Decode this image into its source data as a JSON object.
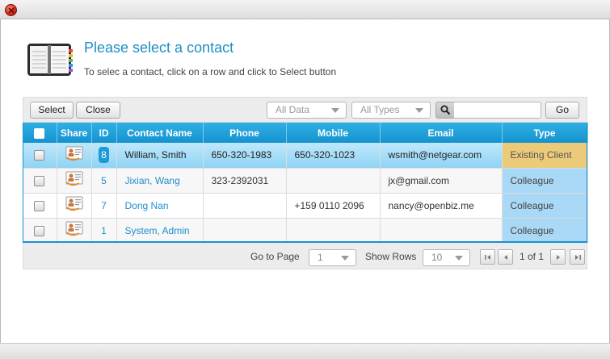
{
  "header": {
    "title": "Please select a contact",
    "subtitle": "To selec a contact, click on a row and click to Select button",
    "icon": "address-book-icon"
  },
  "toolbar": {
    "select_label": "Select",
    "close_label": "Close",
    "filter_data": "All Data",
    "filter_types": "All Types",
    "search_value": "",
    "go_label": "Go"
  },
  "grid": {
    "columns": [
      "Share",
      "ID",
      "Contact Name",
      "Phone",
      "Mobile",
      "Email",
      "Type"
    ],
    "rows": [
      {
        "share": "contact-card-icon",
        "id": "8",
        "name": "William, Smith",
        "phone": "650-320-1983",
        "mobile": "650-320-1023",
        "email": "wsmith@netgear.com",
        "type": "Existing Client",
        "selected": true
      },
      {
        "share": "contact-card-icon",
        "id": "5",
        "name": "Jixian, Wang",
        "phone": "323-2392031",
        "mobile": "",
        "email": "jx@gmail.com",
        "type": "Colleague",
        "selected": false
      },
      {
        "share": "contact-card-icon",
        "id": "7",
        "name": "Dong Nan",
        "phone": "",
        "mobile": "+159 0110 2096",
        "email": "nancy@openbiz.me",
        "type": "Colleague",
        "selected": false
      },
      {
        "share": "contact-card-icon",
        "id": "1",
        "name": "System, Admin",
        "phone": "",
        "mobile": "",
        "email": "",
        "type": "Colleague",
        "selected": false
      }
    ]
  },
  "pager": {
    "goto_label": "Go to Page",
    "page_value": "1",
    "rows_label": "Show Rows",
    "rows_value": "10",
    "page_info": "1 of 1"
  },
  "colors": {
    "accent": "#1e8ec4",
    "header_blue": "#1592cf",
    "selected_row": "#9fd9f6",
    "existing_client": "#ebcb7a",
    "type_cell": "#a9d9f6"
  }
}
